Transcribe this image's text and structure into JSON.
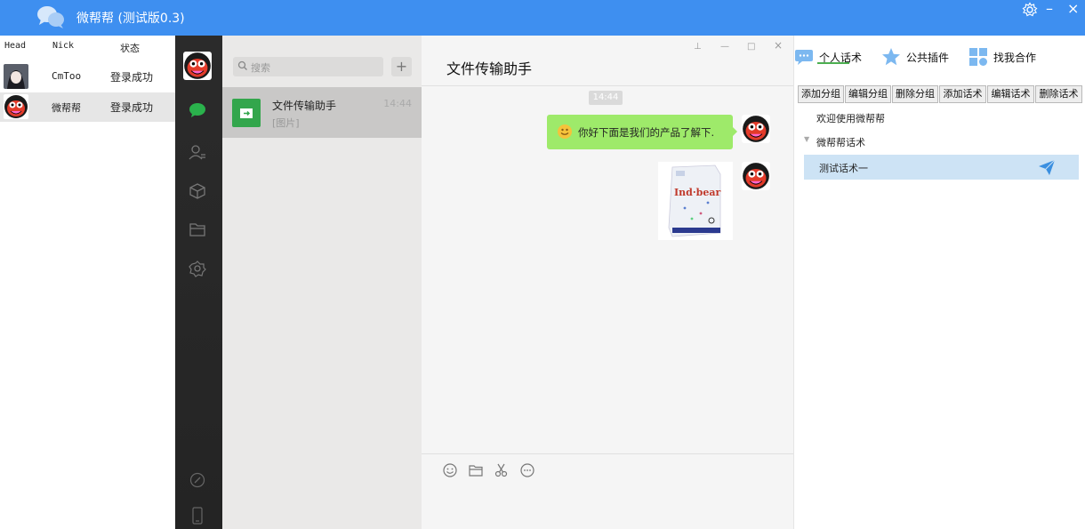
{
  "app": {
    "title": "微帮帮 (测试版0.3)"
  },
  "accounts": {
    "headers": {
      "head": "Head",
      "nick": "Nick",
      "status": "状态"
    },
    "rows": [
      {
        "nick": "CmToo",
        "status": "登录成功",
        "avatar": "anime-avatar"
      },
      {
        "nick": "微帮帮",
        "status": "登录成功",
        "avatar": "cartoon-face-avatar"
      }
    ]
  },
  "sessions": {
    "search_placeholder": "搜索",
    "add_label": "+",
    "items": [
      {
        "name": "文件传输助手",
        "preview": "[图片]",
        "time": "14:44",
        "icon": "file-transfer-icon"
      }
    ]
  },
  "chat": {
    "title": "文件传输助手",
    "time_badge": "14:44",
    "messages": [
      {
        "type": "text",
        "text": "你好下面是我们的产品了解下.",
        "emoji": "smile-emoji"
      },
      {
        "type": "image",
        "image": "product-package-image"
      }
    ],
    "window_controls": {
      "pin": "⊥",
      "minimize": "—",
      "maximize": "□",
      "close": "×"
    }
  },
  "scripts": {
    "tabs": [
      {
        "label": "个人话术",
        "icon": "chat-bubble-icon"
      },
      {
        "label": "公共插件",
        "icon": "star-icon"
      },
      {
        "label": "找我合作",
        "icon": "grid-icon"
      }
    ],
    "buttons": [
      "添加分组",
      "编辑分组",
      "删除分组",
      "添加话术",
      "编辑话术",
      "删除话术"
    ],
    "tree": {
      "top_item": "欢迎使用微帮帮",
      "group": "微帮帮话术",
      "child": "测试话术一"
    }
  },
  "colors": {
    "titlebar": "#3e8ff0",
    "nav_active": "#2ab24c",
    "bubble": "#9eea6a",
    "selected_row": "#cde3f5",
    "tab_underline": "#4caf50"
  }
}
